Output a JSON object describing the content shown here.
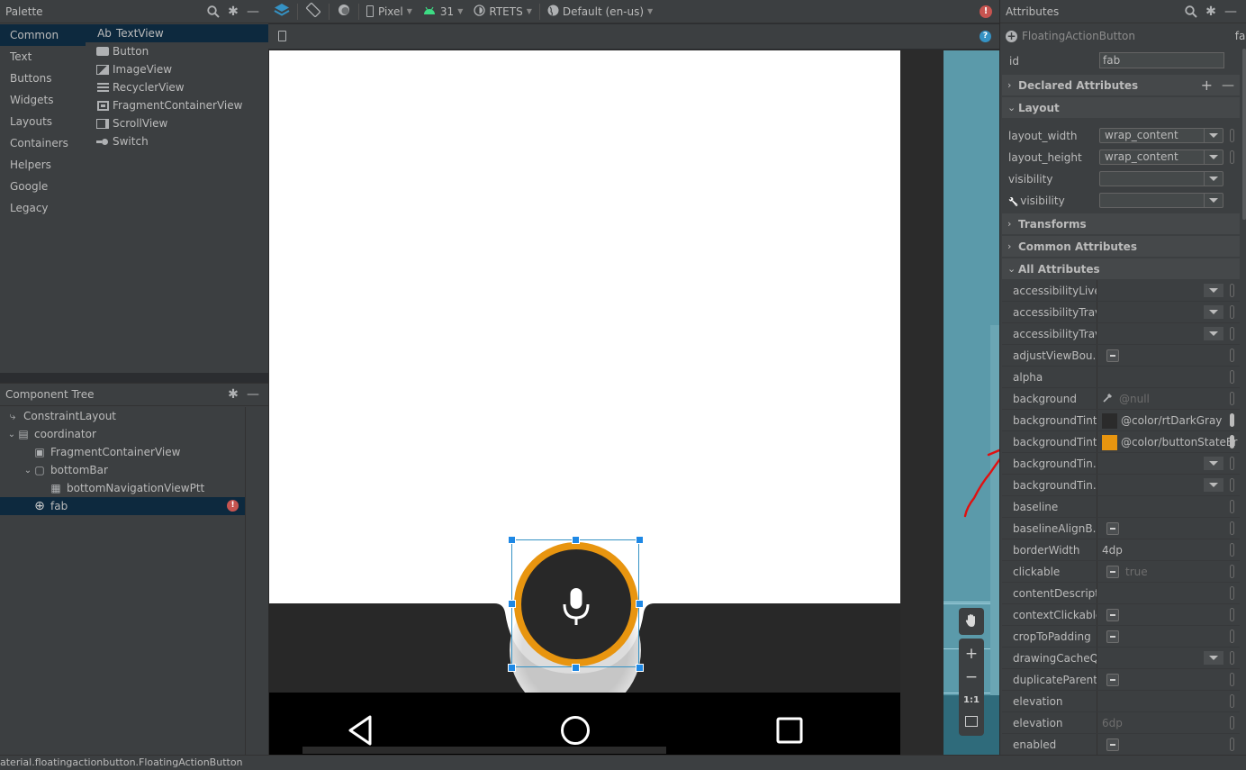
{
  "palette": {
    "title": "Palette",
    "categories": [
      {
        "label": "Common",
        "selected": true
      },
      {
        "label": "Text"
      },
      {
        "label": "Buttons"
      },
      {
        "label": "Widgets"
      },
      {
        "label": "Layouts"
      },
      {
        "label": "Containers"
      },
      {
        "label": "Helpers"
      },
      {
        "label": "Google"
      },
      {
        "label": "Legacy"
      }
    ],
    "items": [
      {
        "label": "TextView",
        "icon": "textview-icon",
        "glyph": "Ab",
        "selected": true
      },
      {
        "label": "Button",
        "icon": "button-icon"
      },
      {
        "label": "ImageView",
        "icon": "imageview-icon"
      },
      {
        "label": "RecyclerView",
        "icon": "recyclerview-icon"
      },
      {
        "label": "FragmentContainerView",
        "icon": "fragment-container-icon"
      },
      {
        "label": "ScrollView",
        "icon": "scrollview-icon"
      },
      {
        "label": "Switch",
        "icon": "switch-icon"
      }
    ]
  },
  "component_tree": {
    "title": "Component Tree",
    "nodes": [
      {
        "label": "ConstraintLayout",
        "depth": 0,
        "expanded": null,
        "icon": "constraint-layout-icon"
      },
      {
        "label": "coordinator",
        "depth": 0,
        "expanded": true,
        "icon": "coordinator-layout-icon"
      },
      {
        "label": "FragmentContainerView",
        "depth": 1,
        "expanded": null,
        "icon": "fragment-container-icon"
      },
      {
        "label": "bottomBar",
        "depth": 1,
        "expanded": true,
        "icon": "bottom-app-bar-icon"
      },
      {
        "label": "bottomNavigationViewPtt",
        "depth": 2,
        "expanded": null,
        "icon": "bottom-navigation-icon"
      },
      {
        "label": "fab",
        "depth": 1,
        "expanded": null,
        "icon": "fab-icon",
        "selected": true,
        "has_error": true
      }
    ]
  },
  "toolbar": {
    "design_surface": "layers-icon",
    "orientation": "rotate-icon",
    "night_mode": "night-mode-icon",
    "device": "Pixel",
    "api_level": "31",
    "theme": "RTETS",
    "locale": "Default (en-us)",
    "error_count_icon": "!",
    "help_icon": "?"
  },
  "canvas": {
    "fab_icon": "microphone-icon",
    "fab_ring_color": "#e8950f",
    "fab_fill_color": "#282828",
    "bottom_bar_color": "#282828",
    "nav_buttons": [
      "back-icon",
      "home-icon",
      "recents-icon"
    ],
    "zoom_controls": {
      "pan": "hand-icon",
      "zoom_in": "+",
      "zoom_out": "−",
      "actual_size": "1:1",
      "fit": "fit-screen-icon"
    }
  },
  "attributes": {
    "title": "Attributes",
    "component_class": "FloatingActionButton",
    "component_id_short": "fab",
    "id_label": "id",
    "id_value": "fab",
    "sections": {
      "declared": "Declared Attributes",
      "layout": "Layout",
      "transforms": "Transforms",
      "common": "Common Attributes",
      "all": "All Attributes"
    },
    "layout_rows": [
      {
        "name": "layout_width",
        "value": "wrap_content"
      },
      {
        "name": "layout_height",
        "value": "wrap_content"
      },
      {
        "name": "visibility",
        "value": ""
      },
      {
        "name": "visibility",
        "value": "",
        "tools": true
      }
    ],
    "all_rows": [
      {
        "name": "accessibilityLive...",
        "type": "dropdown",
        "value": ""
      },
      {
        "name": "accessibilityTrav...",
        "type": "dropdown",
        "value": ""
      },
      {
        "name": "accessibilityTrav...",
        "type": "dropdown",
        "value": ""
      },
      {
        "name": "adjustViewBou...",
        "type": "checkbox",
        "value": ""
      },
      {
        "name": "alpha",
        "type": "text",
        "value": ""
      },
      {
        "name": "background",
        "type": "picker",
        "value": "@null",
        "muted": true
      },
      {
        "name": "backgroundTint",
        "type": "color",
        "value": "@color/rtDarkGray",
        "swatch": "#2b2b2b",
        "set": true
      },
      {
        "name": "backgroundTint",
        "type": "color",
        "value": "@color/buttonStateEr",
        "swatch": "#e8950f",
        "set": true
      },
      {
        "name": "backgroundTin...",
        "type": "dropdown",
        "value": ""
      },
      {
        "name": "backgroundTin...",
        "type": "dropdown",
        "value": ""
      },
      {
        "name": "baseline",
        "type": "text",
        "value": ""
      },
      {
        "name": "baselineAlignB...",
        "type": "checkbox",
        "value": ""
      },
      {
        "name": "borderWidth",
        "type": "text",
        "value": "4dp"
      },
      {
        "name": "clickable",
        "type": "checkbox",
        "value": "true",
        "muted": true
      },
      {
        "name": "contentDescript...",
        "type": "text",
        "value": ""
      },
      {
        "name": "contextClickable",
        "type": "checkbox",
        "value": ""
      },
      {
        "name": "cropToPadding",
        "type": "checkbox",
        "value": ""
      },
      {
        "name": "drawingCacheQ...",
        "type": "dropdown",
        "value": ""
      },
      {
        "name": "duplicateParent...",
        "type": "checkbox",
        "value": ""
      },
      {
        "name": "elevation",
        "type": "text",
        "value": ""
      },
      {
        "name": "elevation",
        "type": "text",
        "value": "6dp",
        "muted": true
      },
      {
        "name": "enabled",
        "type": "checkbox",
        "value": ""
      }
    ]
  },
  "annotation": {
    "arrow_color": "#e01010",
    "points_to": "backgroundTint"
  },
  "status_bar": {
    "text": "aterial.floatingactionbutton.FloatingActionButton"
  }
}
